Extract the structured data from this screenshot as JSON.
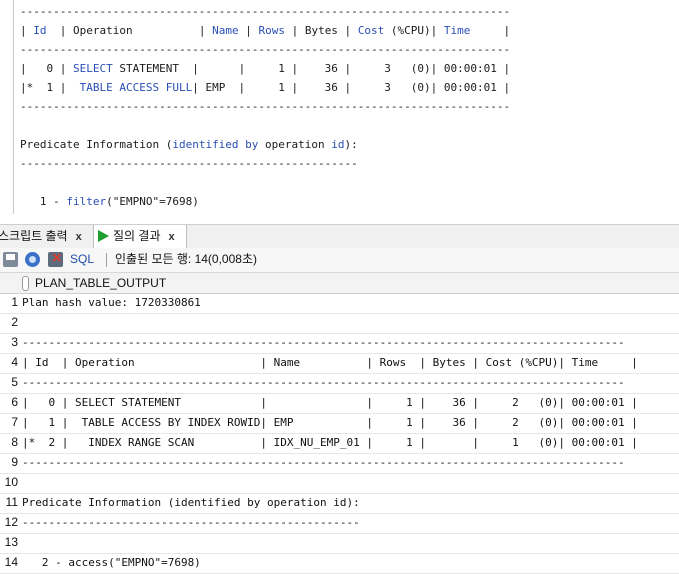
{
  "editor": {
    "lines": [
      {
        "parts": [
          {
            "t": "--------------------------------------------------------------------------",
            "c": "num"
          }
        ]
      },
      {
        "parts": [
          {
            "t": "| ",
            "c": "num"
          },
          {
            "t": "Id",
            "c": "kw"
          },
          {
            "t": "  | Operation          | ",
            "c": "num"
          },
          {
            "t": "Name",
            "c": "kw"
          },
          {
            "t": " | ",
            "c": "num"
          },
          {
            "t": "Rows",
            "c": "kw"
          },
          {
            "t": " | Bytes | ",
            "c": "num"
          },
          {
            "t": "Cost",
            "c": "kw"
          },
          {
            "t": " (%CPU)| ",
            "c": "num"
          },
          {
            "t": "Time",
            "c": "kw"
          },
          {
            "t": "     |",
            "c": "num"
          }
        ]
      },
      {
        "parts": [
          {
            "t": "--------------------------------------------------------------------------",
            "c": "num"
          }
        ]
      },
      {
        "parts": [
          {
            "t": "|   0 | ",
            "c": "num"
          },
          {
            "t": "SELECT",
            "c": "kw"
          },
          {
            "t": " STATEMENT  |      |     1 |    36 |     3   (0)| 00:00:01 |",
            "c": "num"
          }
        ]
      },
      {
        "parts": [
          {
            "t": "|*  1 |  ",
            "c": "num"
          },
          {
            "t": "TABLE ACCESS FULL",
            "c": "kw"
          },
          {
            "t": "| EMP  |     1 |    36 |     3   (0)| 00:00:01 |",
            "c": "num"
          }
        ]
      },
      {
        "parts": [
          {
            "t": "--------------------------------------------------------------------------",
            "c": "num"
          }
        ]
      },
      {
        "parts": []
      },
      {
        "parts": [
          {
            "t": "Predicate Information (",
            "c": "num"
          },
          {
            "t": "identified by",
            "c": "kw"
          },
          {
            "t": " operation ",
            "c": "num"
          },
          {
            "t": "id",
            "c": "kw"
          },
          {
            "t": "):",
            "c": "num"
          }
        ]
      },
      {
        "parts": [
          {
            "t": "---------------------------------------------------",
            "c": "num"
          }
        ]
      },
      {
        "parts": []
      },
      {
        "parts": [
          {
            "t": "   1 - ",
            "c": "num"
          },
          {
            "t": "filter",
            "c": "kw"
          },
          {
            "t": "(\"EMPNO\"=7698)",
            "c": "num"
          }
        ]
      }
    ]
  },
  "tabs": [
    {
      "label": "스크립트 출력",
      "close": "x",
      "active": false
    },
    {
      "label": "질의 결과",
      "close": "x",
      "active": true
    }
  ],
  "toolbar": {
    "sql_label": "SQL",
    "fetch_status": "인출된 모든 행: 14(0,008초)"
  },
  "grid": {
    "column_header": "PLAN_TABLE_OUTPUT",
    "rows": [
      {
        "n": "1",
        "text": "Plan hash value: 1720330861"
      },
      {
        "n": "2",
        "text": ""
      },
      {
        "n": "3",
        "text": "-------------------------------------------------------------------------------------------"
      },
      {
        "n": "4",
        "text": "| Id  | Operation                   | Name          | Rows  | Bytes | Cost (%CPU)| Time     |"
      },
      {
        "n": "5",
        "text": "-------------------------------------------------------------------------------------------"
      },
      {
        "n": "6",
        "text": "|   0 | SELECT STATEMENT            |               |     1 |    36 |     2   (0)| 00:00:01 |"
      },
      {
        "n": "7",
        "text": "|   1 |  TABLE ACCESS BY INDEX ROWID| EMP           |     1 |    36 |     2   (0)| 00:00:01 |"
      },
      {
        "n": "8",
        "text": "|*  2 |   INDEX RANGE SCAN          | IDX_NU_EMP_01 |     1 |       |     1   (0)| 00:00:01 |"
      },
      {
        "n": "9",
        "text": "-------------------------------------------------------------------------------------------"
      },
      {
        "n": "10",
        "text": ""
      },
      {
        "n": "11",
        "text": "Predicate Information (identified by operation id):"
      },
      {
        "n": "12",
        "text": "---------------------------------------------------"
      },
      {
        "n": "13",
        "text": ""
      },
      {
        "n": "14",
        "text": "   2 - access(\"EMPNO\"=7698)"
      }
    ]
  }
}
